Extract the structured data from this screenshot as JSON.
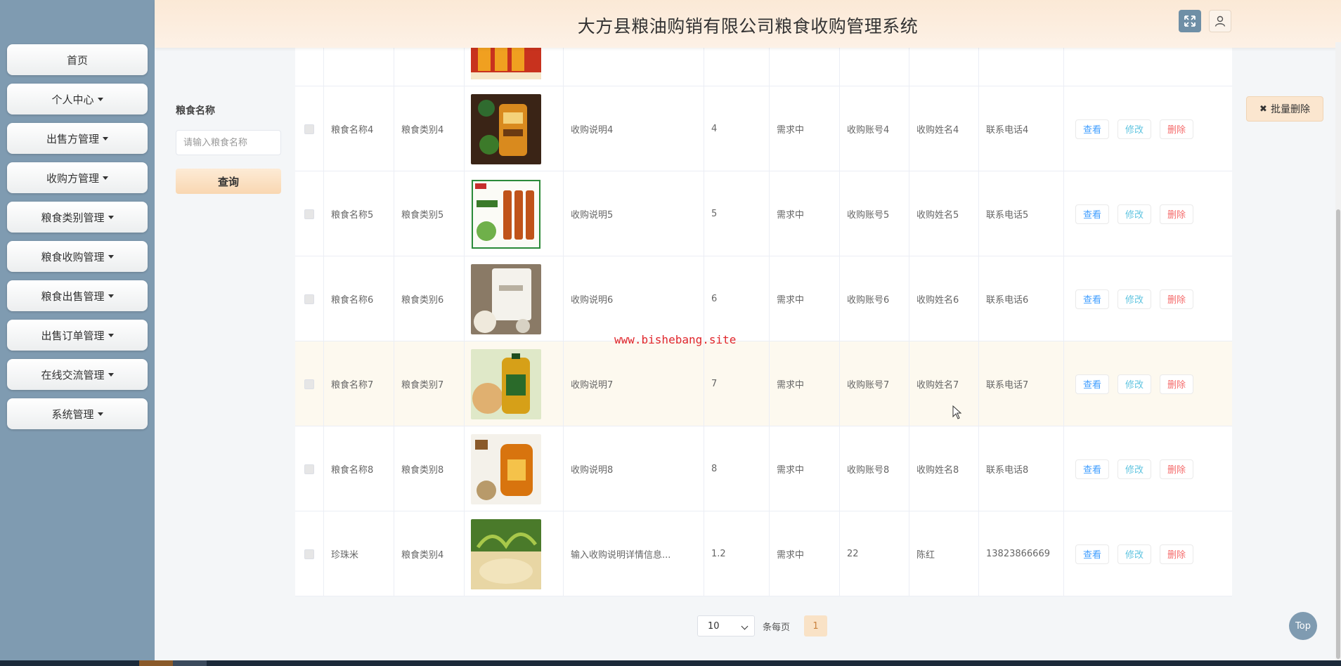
{
  "header": {
    "title": "大方县粮油购销有限公司粮食收购管理系统"
  },
  "sidebar": {
    "items": [
      {
        "label": "首页",
        "dropdown": false
      },
      {
        "label": "个人中心",
        "dropdown": true
      },
      {
        "label": "出售方管理",
        "dropdown": true
      },
      {
        "label": "收购方管理",
        "dropdown": true
      },
      {
        "label": "粮食类别管理",
        "dropdown": true
      },
      {
        "label": "粮食收购管理",
        "dropdown": true
      },
      {
        "label": "粮食出售管理",
        "dropdown": true
      },
      {
        "label": "出售订单管理",
        "dropdown": true
      },
      {
        "label": "在线交流管理",
        "dropdown": true
      },
      {
        "label": "系统管理",
        "dropdown": true
      }
    ]
  },
  "search": {
    "label": "粮食名称",
    "placeholder": "请输入粮食名称",
    "button": "查询"
  },
  "batch_delete": "批量删除",
  "actions": {
    "view": "查看",
    "edit": "修改",
    "delete": "删除"
  },
  "rows": [
    {
      "name": "粮食名称4",
      "category": "粮食类别4",
      "desc": "收购说明4",
      "qty": "4",
      "status": "需求中",
      "account": "收购账号4",
      "buyer": "收购姓名4",
      "phone": "联系电话4",
      "image": "oil-bottle-dark"
    },
    {
      "name": "粮食名称5",
      "category": "粮食类别5",
      "desc": "收购说明5",
      "qty": "5",
      "status": "需求中",
      "account": "收购账号5",
      "buyer": "收购姓名5",
      "phone": "联系电话5",
      "image": "cooking-wine-bottles"
    },
    {
      "name": "粮食名称6",
      "category": "粮食类别6",
      "desc": "收购说明6",
      "qty": "6",
      "status": "需求中",
      "account": "收购账号6",
      "buyer": "收购姓名6",
      "phone": "联系电话6",
      "image": "rice-bag"
    },
    {
      "name": "粮食名称7",
      "category": "粮食类别7",
      "desc": "收购说明7",
      "qty": "7",
      "status": "需求中",
      "account": "收购账号7",
      "buyer": "收购姓名7",
      "phone": "联系电话7",
      "image": "oil-jug-green"
    },
    {
      "name": "粮食名称8",
      "category": "粮食类别8",
      "desc": "收购说明8",
      "qty": "8",
      "status": "需求中",
      "account": "收购账号8",
      "buyer": "收购姓名8",
      "phone": "联系电话8",
      "image": "oil-jug-orange"
    },
    {
      "name": "珍珠米",
      "category": "粮食类别4",
      "desc": "输入收购说明详情信息...",
      "qty": "1.2",
      "status": "需求中",
      "account": "22",
      "buyer": "陈红",
      "phone": "13823866669",
      "image": "rice-plant"
    }
  ],
  "watermark": "www.bishebang.site",
  "pagination": {
    "page_size": "10",
    "per_page_label": "条每页",
    "current_page": "1"
  },
  "top_button": "Top"
}
